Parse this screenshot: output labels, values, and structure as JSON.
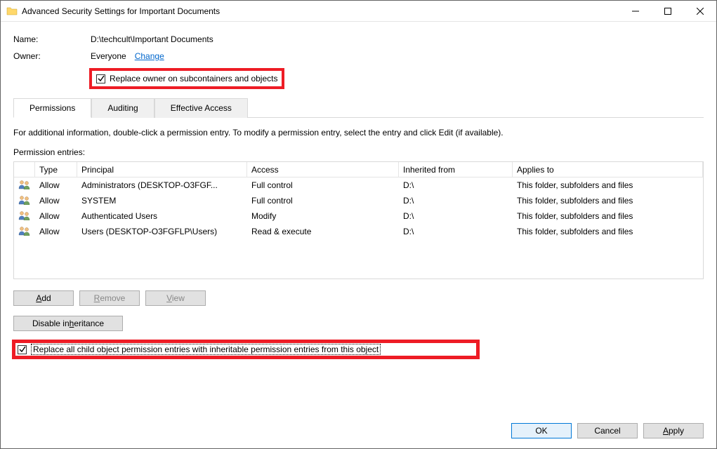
{
  "window": {
    "title": "Advanced Security Settings for Important Documents"
  },
  "info": {
    "name_label": "Name:",
    "name_value": "D:\\techcult\\Important Documents",
    "owner_label": "Owner:",
    "owner_value": "Everyone",
    "change_link": "Change",
    "replace_owner_label": "Replace owner on subcontainers and objects"
  },
  "tabs": {
    "permissions": "Permissions",
    "auditing": "Auditing",
    "effective": "Effective Access"
  },
  "body": {
    "instruction": "For additional information, double-click a permission entry. To modify a permission entry, select the entry and click Edit (if available).",
    "entries_label": "Permission entries:"
  },
  "grid": {
    "headers": {
      "type": "Type",
      "principal": "Principal",
      "access": "Access",
      "inherited": "Inherited from",
      "applies": "Applies to"
    },
    "rows": [
      {
        "type": "Allow",
        "principal": "Administrators (DESKTOP-O3FGF...",
        "access": "Full control",
        "inherited": "D:\\",
        "applies": "This folder, subfolders and files"
      },
      {
        "type": "Allow",
        "principal": "SYSTEM",
        "access": "Full control",
        "inherited": "D:\\",
        "applies": "This folder, subfolders and files"
      },
      {
        "type": "Allow",
        "principal": "Authenticated Users",
        "access": "Modify",
        "inherited": "D:\\",
        "applies": "This folder, subfolders and files"
      },
      {
        "type": "Allow",
        "principal": "Users (DESKTOP-O3FGFLP\\Users)",
        "access": "Read & execute",
        "inherited": "D:\\",
        "applies": "This folder, subfolders and files"
      }
    ]
  },
  "buttons": {
    "add": "Add",
    "remove": "Remove",
    "view": "View",
    "disable_inheritance": "Disable inheritance",
    "replace_child_label": "Replace all child object permission entries with inheritable permission entries from this object",
    "ok": "OK",
    "cancel": "Cancel",
    "apply": "Apply"
  }
}
